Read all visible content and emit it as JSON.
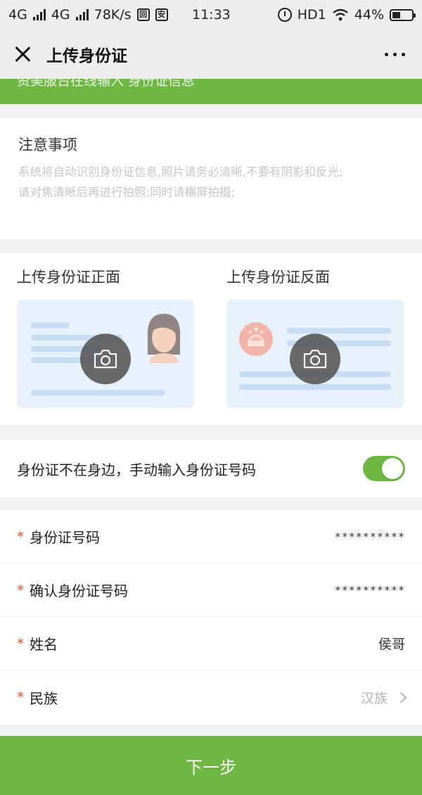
{
  "status_bar": {
    "net1": "4G",
    "net2": "4G",
    "speed": "78K/s",
    "time": "11:33",
    "hd": "HD1",
    "battery": "44%",
    "battery_level": 0.44
  },
  "nav": {
    "title": "上传身份证"
  },
  "banner": {
    "text": "资美服台在线输入 身份证信息"
  },
  "notice": {
    "title": "注意事项",
    "line1": "系统将自动识别身份证信息,照片请务必清晰,不要有阴影和反光;",
    "line2": "请对焦清晰后再进行拍照;同时请横屏拍摄;"
  },
  "upload": {
    "front_label": "上传身份证正面",
    "back_label": "上传身份证反面"
  },
  "manual": {
    "label": "身份证不在身边，手动输入身份证号码",
    "enabled": true
  },
  "form": {
    "required_mark": "*",
    "id_number_label": "身份证号码",
    "id_number_value": "**********",
    "confirm_id_label": "确认身份证号码",
    "confirm_id_value": "**********",
    "name_label": "姓名",
    "name_value": "侯哥",
    "ethnicity_label": "民族",
    "ethnicity_value": "汉族"
  },
  "actions": {
    "next_label": "下一步"
  },
  "colors": {
    "accent": "#6fb743",
    "required": "#e4572e"
  }
}
